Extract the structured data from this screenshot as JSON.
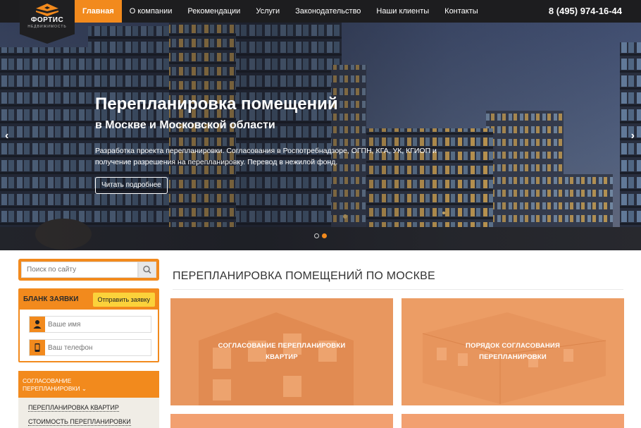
{
  "brand": {
    "name": "ФОРТИС",
    "subtitle": "НЕДВИЖИМОСТЬ",
    "accent": "#f28a1d",
    "dark": "#1d1d1f"
  },
  "nav": {
    "items": [
      {
        "label": "Главная"
      },
      {
        "label": "О компании"
      },
      {
        "label": "Рекомендации"
      },
      {
        "label": "Услуги"
      },
      {
        "label": "Законодательство"
      },
      {
        "label": "Наши клиенты"
      },
      {
        "label": "Контакты"
      }
    ],
    "active_index": 0,
    "phone": "8 (495) 974-16-44"
  },
  "hero": {
    "title": "Перепланировка помещений",
    "subtitle": "в Москве и Московской области",
    "text": "Разработка проекта перепланировки. Согласования в Роспотребнадзоре, ОГПН, КГА, УК, КГИОП и получение разрешения на перепланировку. Перевод в нежилой фонд.",
    "button": "Читать подробнее",
    "prev_icon": "chevron-left-icon",
    "next_icon": "chevron-right-icon",
    "slides_count": 2,
    "active_slide": 2
  },
  "sidebar": {
    "search": {
      "placeholder": "Поиск по сайту",
      "icon": "search-icon"
    },
    "order_form": {
      "title": "БЛАНК ЗАЯВКИ",
      "submit": "Отправить заявку",
      "name_placeholder": "Ваше имя",
      "phone_placeholder": "Ваш телефон",
      "name_icon": "user-icon",
      "phone_icon": "mobile-phone-icon"
    },
    "menu": {
      "header_line1": "СОГЛАСОВАНИЕ",
      "header_line2": "ПЕРЕПЛАНИРОВКИ",
      "caret": "chevron-down-icon",
      "items": [
        {
          "label": "ПЕРЕПЛАНИРОВКА КВАРТИР"
        },
        {
          "label": "СТОИМОСТЬ ПЕРЕПЛАНИРОВКИ"
        }
      ]
    }
  },
  "main": {
    "title": "ПЕРЕПЛАНИРОВКА ПОМЕЩЕНИЙ ПО МОСКВЕ",
    "cards": [
      {
        "line1": "СОГЛАСОВАНИЕ ПЕРЕПЛАНИРОВКИ",
        "line2": "КВАРТИР"
      },
      {
        "line1": "ПОРЯДОК СОГЛАСОВАНИЯ",
        "line2": "ПЕРЕПЛАНИРОВКИ"
      },
      {
        "line1": "",
        "line2": ""
      },
      {
        "line1": "",
        "line2": ""
      }
    ]
  }
}
